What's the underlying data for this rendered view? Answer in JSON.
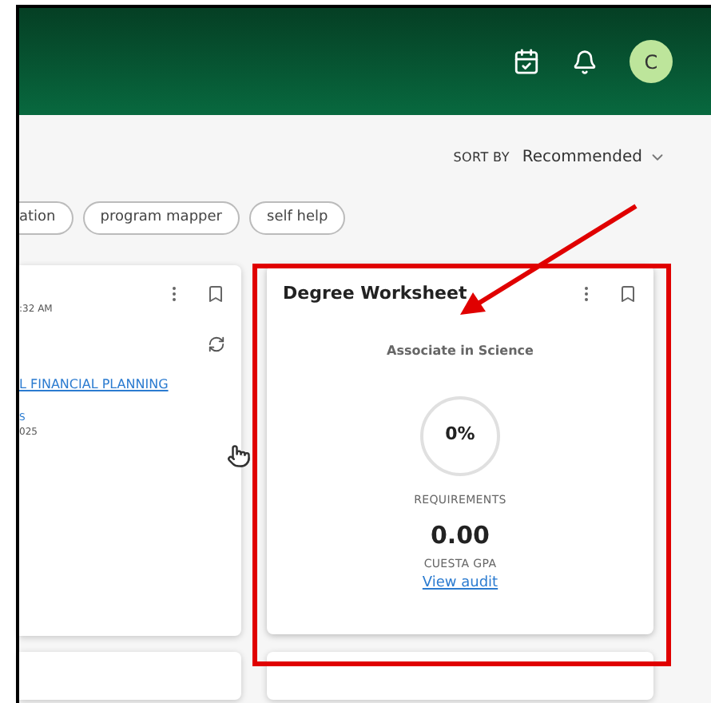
{
  "header": {
    "avatar": "C"
  },
  "sort": {
    "label": "SORT BY",
    "value": "Recommended"
  },
  "chips": [
    "ation",
    "program mapper",
    "self help"
  ],
  "left_card": {
    "time": ":32 AM",
    "link": "L FINANCIAL PLANNING",
    "line_1": "S",
    "line_2": "025"
  },
  "degree_card": {
    "title": "Degree Worksheet",
    "program": "Associate in Science",
    "progress": "0%",
    "level": 0,
    "progress_label": "REQUIREMENTS",
    "gpa": "0.00",
    "gpa_label": "CUESTA GPA",
    "link": "View audit"
  }
}
